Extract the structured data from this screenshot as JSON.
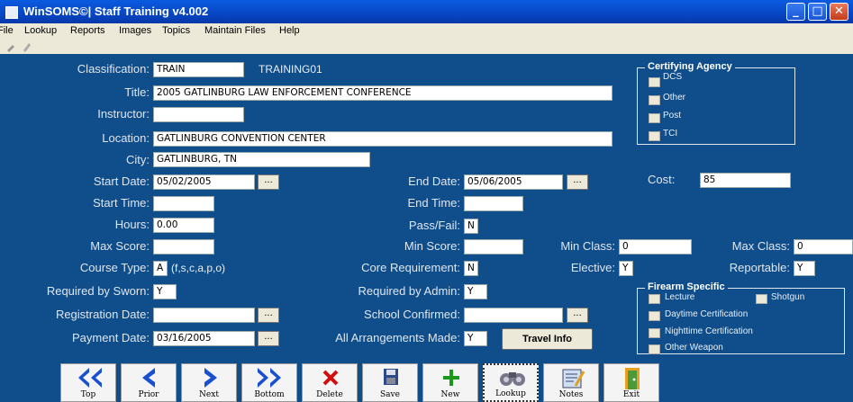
{
  "window": {
    "title": "WinSOMS©| Staff Training v4.002"
  },
  "menu": [
    "File",
    "Lookup",
    "Reports",
    "Images",
    "Topics",
    "Maintain Files",
    "Help"
  ],
  "form": {
    "classification": {
      "label": "Classification:",
      "value": "TRAIN",
      "code": "TRAINING01"
    },
    "title": {
      "label": "Title:",
      "value": "2005 GATLINBURG LAW ENFORCEMENT CONFERENCE"
    },
    "instructor": {
      "label": "Instructor:",
      "value": ""
    },
    "location": {
      "label": "Location:",
      "value": "GATLINBURG CONVENTION CENTER"
    },
    "city": {
      "label": "City:",
      "value": "GATLINBURG, TN"
    },
    "start_date": {
      "label": "Start Date:",
      "value": "05/02/2005"
    },
    "end_date": {
      "label": "End Date:",
      "value": "05/06/2005"
    },
    "cost": {
      "label": "Cost:",
      "value": "85"
    },
    "start_time": {
      "label": "Start Time:",
      "value": ""
    },
    "end_time": {
      "label": "End Time:",
      "value": ""
    },
    "hours": {
      "label": "Hours:",
      "value": "0.00"
    },
    "pass_fail": {
      "label": "Pass/Fail:",
      "value": "N"
    },
    "max_score": {
      "label": "Max Score:",
      "value": ""
    },
    "min_score": {
      "label": "Min Score:",
      "value": ""
    },
    "min_class": {
      "label": "Min Class:",
      "value": "0"
    },
    "max_class": {
      "label": "Max Class:",
      "value": "0"
    },
    "course_type": {
      "label": "Course Type:",
      "value": "A",
      "hint": "(f,s,c,a,p,o)"
    },
    "core_requirement": {
      "label": "Core Requirement:",
      "value": "N"
    },
    "elective": {
      "label": "Elective:",
      "value": "Y"
    },
    "reportable": {
      "label": "Reportable:",
      "value": "Y"
    },
    "required_by_sworn": {
      "label": "Required by Sworn:",
      "value": "Y"
    },
    "required_by_admin": {
      "label": "Required by Admin:",
      "value": "Y"
    },
    "registration_date": {
      "label": "Registration Date:",
      "value": ""
    },
    "school_confirmed": {
      "label": "School Confirmed:",
      "value": ""
    },
    "payment_date": {
      "label": "Payment Date:",
      "value": "03/16/2005"
    },
    "all_arrangements": {
      "label": "All Arrangements Made:",
      "value": "Y"
    },
    "dots": "...",
    "travel_button": "Travel Info"
  },
  "certifying_agency": {
    "title": "Certifying Agency",
    "options": [
      "DCS",
      "Other",
      "Post",
      "TCI"
    ]
  },
  "firearm_specific": {
    "title": "Firearm Specific",
    "options": [
      "Lecture",
      "Shotgun",
      "Daytime Certification",
      "Nighttime Certification",
      "Other Weapon"
    ]
  },
  "toolbar": [
    "Top",
    "Prior",
    "Next",
    "Bottom",
    "Delete",
    "Save",
    "New",
    "Lookup",
    "Notes",
    "Exit"
  ],
  "colors": {
    "form_bg": "#104e8b",
    "titlebar": "#0846c4",
    "nav_arrow": "#1a4fd0",
    "delete": "#d01010",
    "new": "#1a9a1a"
  }
}
